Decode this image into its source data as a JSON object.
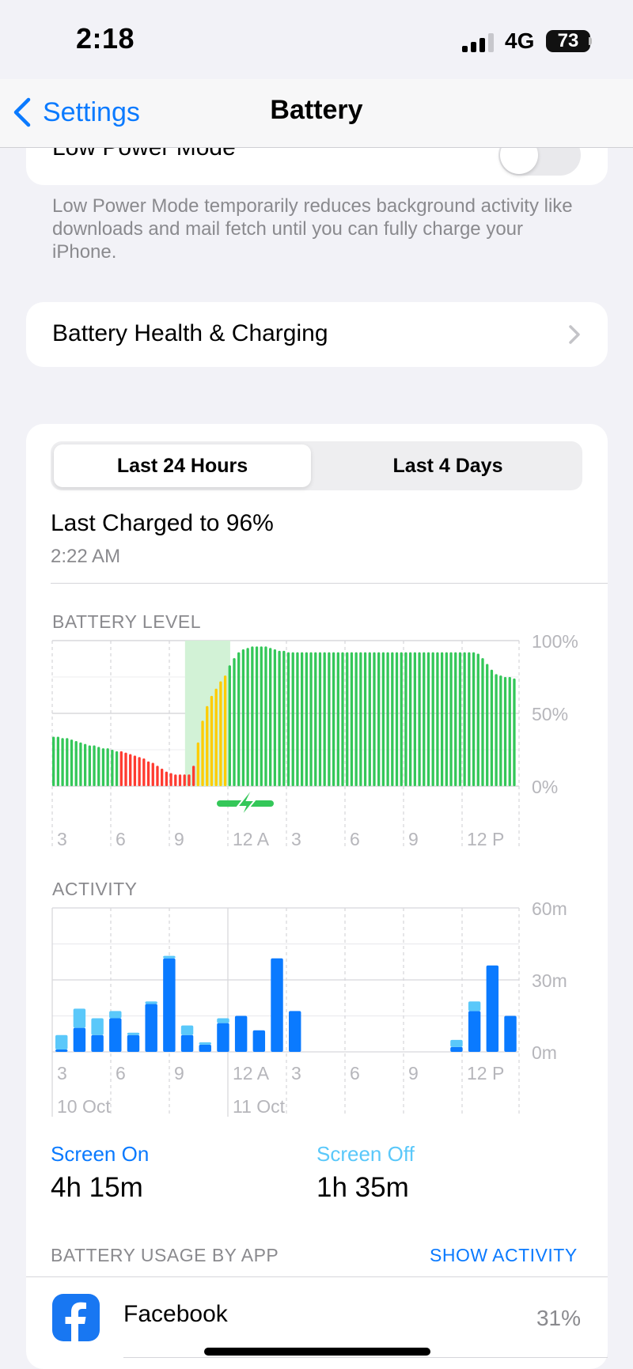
{
  "status": {
    "time": "2:18",
    "network": "4G",
    "battery": "73"
  },
  "nav": {
    "back_label": "Settings",
    "title": "Battery"
  },
  "low_power": {
    "label": "Low Power Mode",
    "enabled": false,
    "footnote": "Low Power Mode temporarily reduces background activity like downloads and mail fetch until you can fully charge your iPhone."
  },
  "battery_health": {
    "label": "Battery Health & Charging"
  },
  "segment": {
    "tabs": [
      "Last 24 Hours",
      "Last 4 Days"
    ],
    "selected": "Last 24 Hours"
  },
  "last_charged": {
    "title": "Last Charged to 96%",
    "time": "2:22 AM"
  },
  "colors": {
    "green": "#34c759",
    "red": "#ff3b30",
    "yellow": "#ffcc00",
    "blue_dark": "#0a7aff",
    "blue_light": "#5ac8fa",
    "charge_band": "#d2f2d6"
  },
  "usage": {
    "heading": "BATTERY USAGE BY APP",
    "action": "SHOW ACTIVITY"
  },
  "apps": [
    {
      "name": "Facebook",
      "percent": "31%",
      "icon": "facebook-icon"
    }
  ],
  "screen": {
    "on_label": "Screen On",
    "on_value": "4h 15m",
    "off_label": "Screen Off",
    "off_value": "1h 35m"
  },
  "chart_data": [
    {
      "type": "bar",
      "title": "BATTERY LEVEL",
      "y_ticks": [
        "100%",
        "50%",
        "0%"
      ],
      "ylim": [
        0,
        100
      ],
      "x_ticks": [
        "3",
        "6",
        "9",
        "12 A",
        "3",
        "6",
        "9",
        "12 P"
      ],
      "charging_window": {
        "from_bar": 30,
        "to_bar": 39
      },
      "series": [
        {
          "values": [
            34,
            34,
            33,
            33,
            32,
            31,
            30,
            29,
            28,
            28,
            27,
            26,
            26,
            25,
            24,
            24,
            23,
            22,
            21,
            20,
            19,
            17,
            16,
            14,
            12,
            10,
            9,
            8,
            8,
            8,
            8,
            14,
            30,
            45,
            55,
            62,
            67,
            72,
            76,
            83,
            88,
            92,
            94,
            95,
            96,
            96,
            96,
            96,
            95,
            94,
            93,
            93,
            92,
            92,
            92,
            92,
            92,
            92,
            92,
            92,
            92,
            92,
            92,
            92,
            92,
            92,
            92,
            92,
            92,
            92,
            92,
            92,
            92,
            92,
            92,
            92,
            92,
            92,
            92,
            92,
            92,
            92,
            92,
            92,
            92,
            92,
            92,
            92,
            92,
            92,
            92,
            92,
            92,
            92,
            91,
            88,
            84,
            80,
            77,
            76,
            75,
            75,
            74
          ],
          "colors": [
            "green",
            "green",
            "green",
            "green",
            "green",
            "green",
            "green",
            "green",
            "green",
            "green",
            "green",
            "green",
            "green",
            "green",
            "green",
            "red",
            "red",
            "red",
            "red",
            "red",
            "red",
            "red",
            "red",
            "red",
            "red",
            "red",
            "red",
            "red",
            "red",
            "red",
            "red",
            "red",
            "yellow",
            "yellow",
            "yellow",
            "yellow",
            "yellow",
            "yellow",
            "yellow",
            "green",
            "green",
            "green",
            "green",
            "green",
            "green",
            "green",
            "green",
            "green",
            "green",
            "green",
            "green",
            "green",
            "green",
            "green",
            "green",
            "green",
            "green",
            "green",
            "green",
            "green",
            "green",
            "green",
            "green",
            "green",
            "green",
            "green",
            "green",
            "green",
            "green",
            "green",
            "green",
            "green",
            "green",
            "green",
            "green",
            "green",
            "green",
            "green",
            "green",
            "green",
            "green",
            "green",
            "green",
            "green",
            "green",
            "green",
            "green",
            "green",
            "green",
            "green",
            "green",
            "green",
            "green",
            "green",
            "green",
            "green",
            "green",
            "green",
            "green",
            "green",
            "green",
            "green",
            "green"
          ]
        }
      ]
    },
    {
      "type": "bar",
      "title": "ACTIVITY",
      "unit": "minutes",
      "y_ticks": [
        "60m",
        "30m",
        "0m"
      ],
      "ylim": [
        0,
        60
      ],
      "x_ticks": [
        "3",
        "6",
        "9",
        "12 A",
        "3",
        "6",
        "9",
        "12 P"
      ],
      "date_labels": [
        "10 Oct",
        "11 Oct"
      ],
      "series": [
        {
          "name": "Screen On",
          "values": [
            1,
            10,
            7,
            14,
            7,
            20,
            39,
            7,
            3,
            12,
            15,
            9,
            39,
            17,
            0,
            0,
            0,
            0,
            0,
            0,
            0,
            0,
            2,
            17,
            36,
            15
          ]
        },
        {
          "name": "Screen Off",
          "values": [
            6,
            8,
            7,
            3,
            1,
            1,
            1,
            4,
            1,
            2,
            0,
            0,
            0,
            0,
            0,
            0,
            0,
            0,
            0,
            0,
            0,
            0,
            3,
            4,
            0,
            0
          ]
        }
      ]
    }
  ]
}
